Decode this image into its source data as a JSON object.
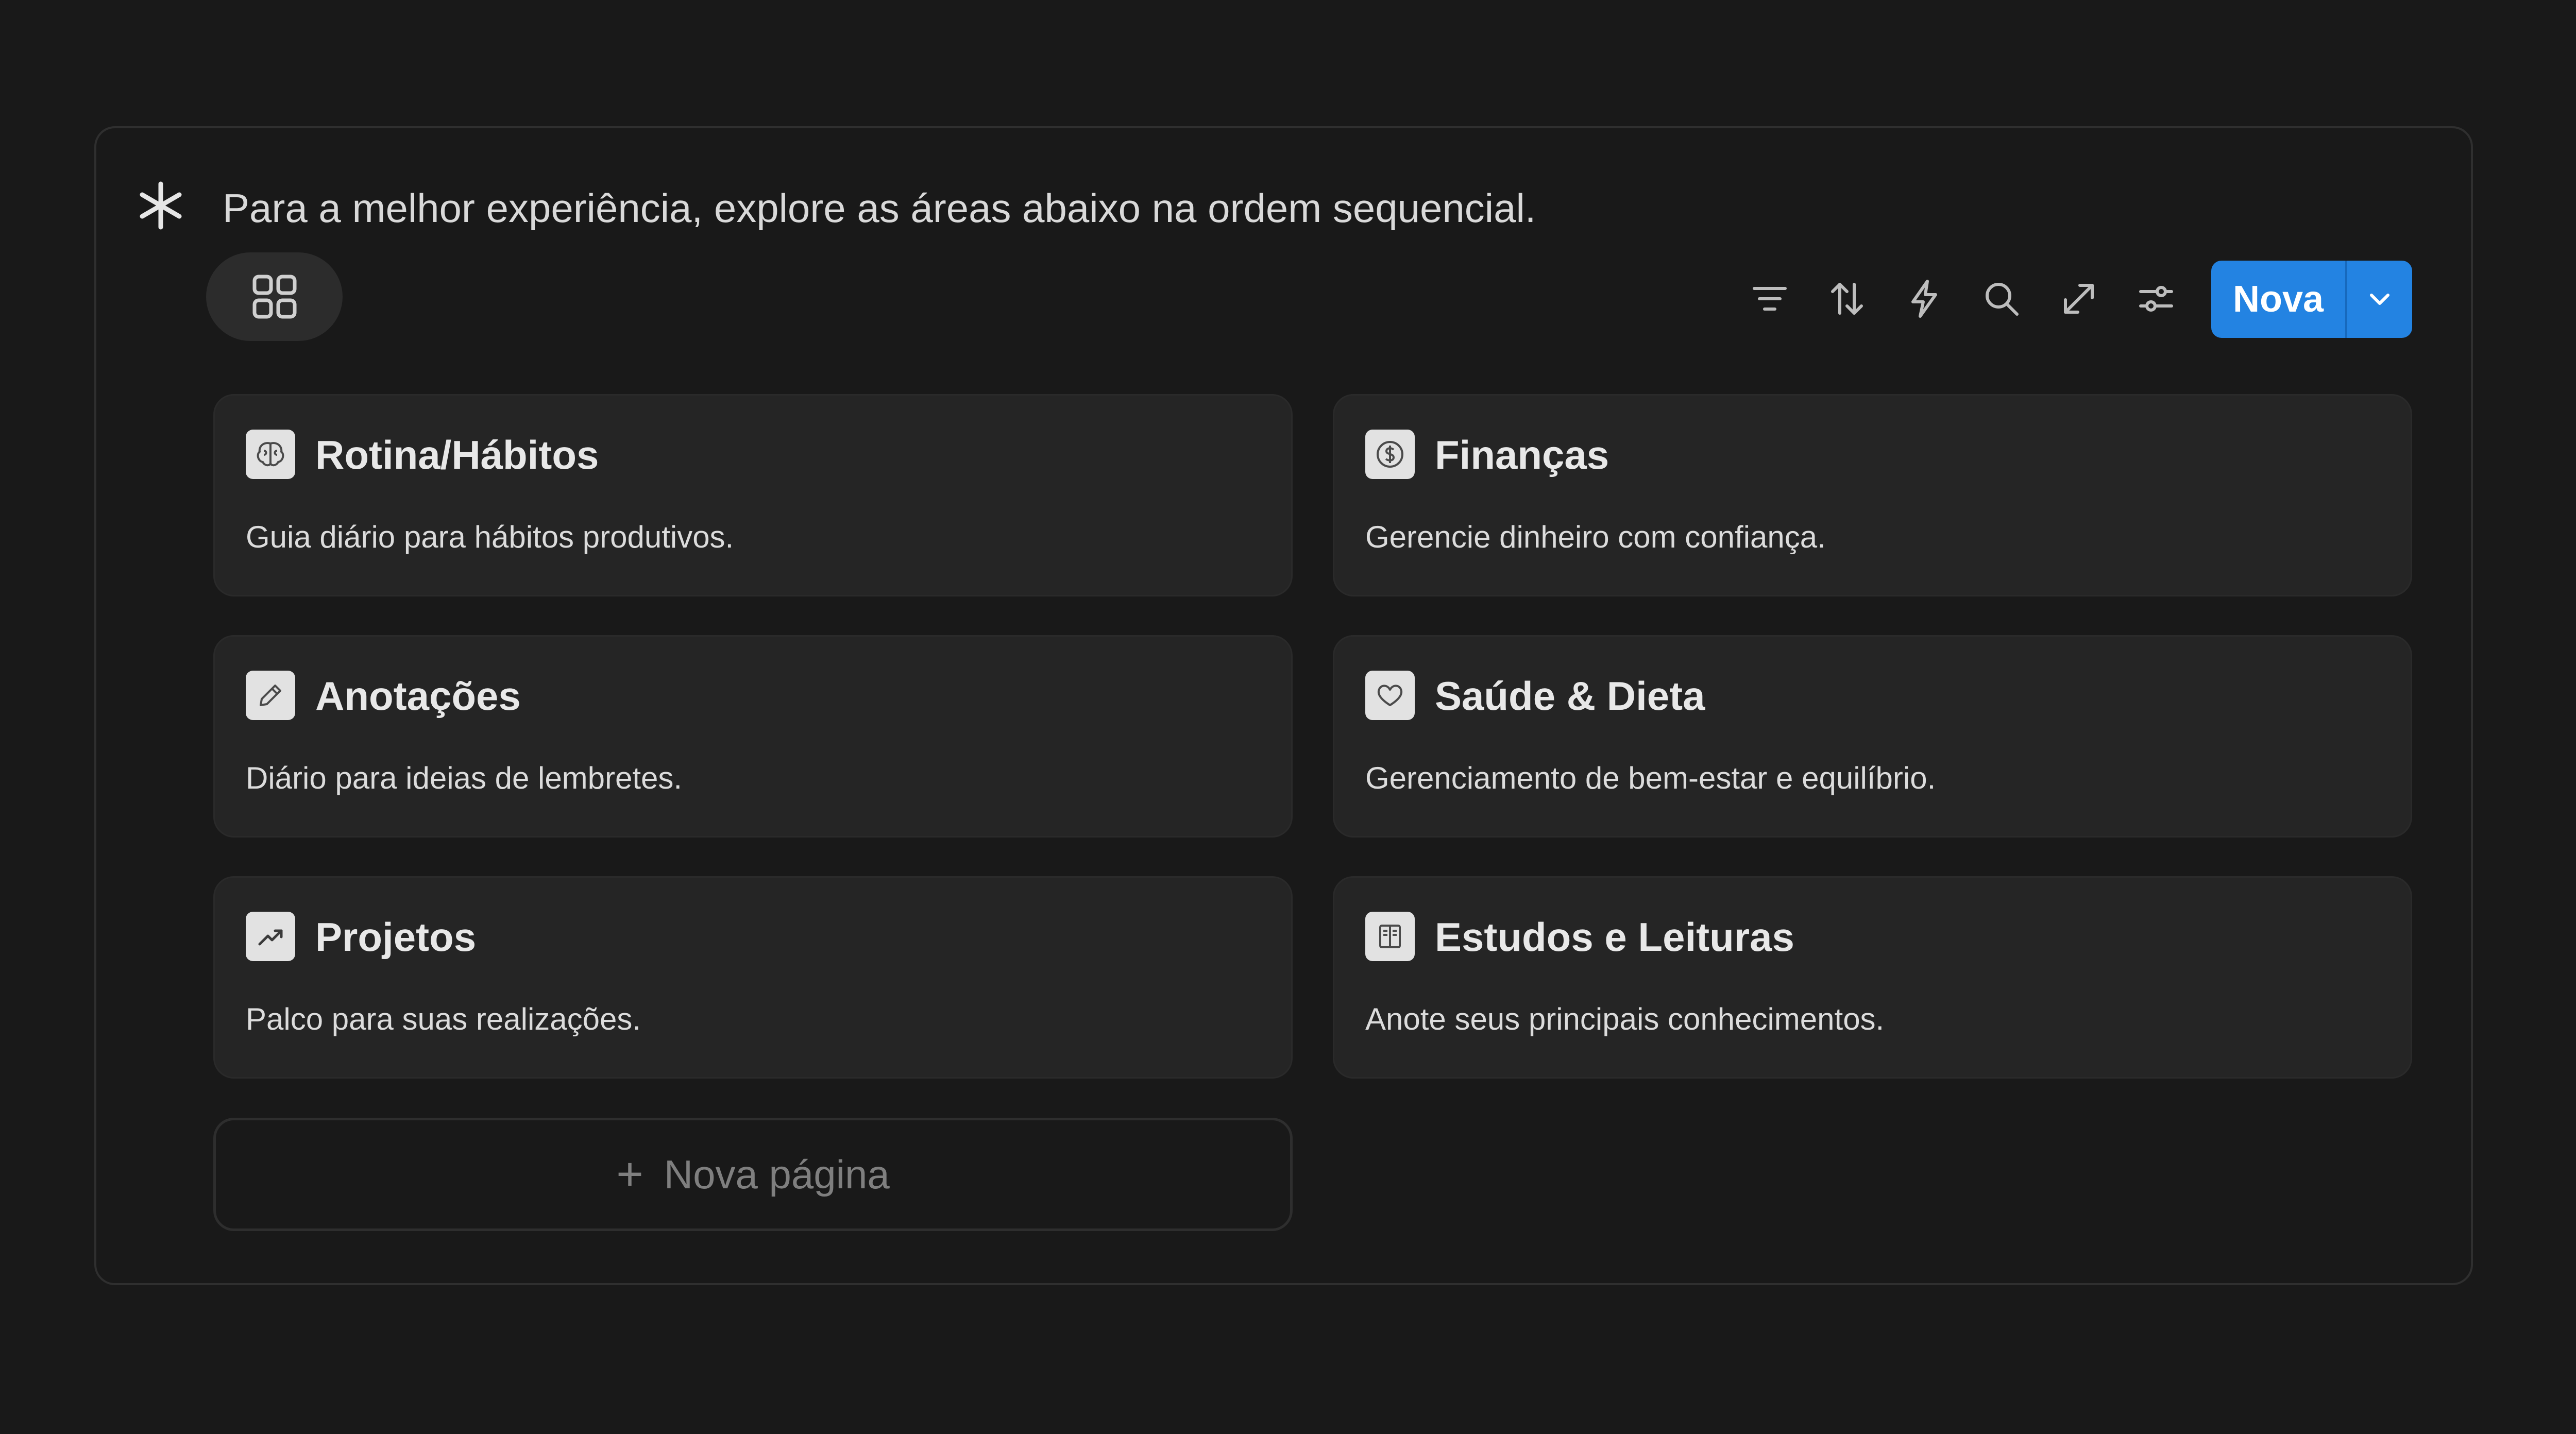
{
  "callout": {
    "icon": "asterisk-icon",
    "text": "Para a melhor experiência, explore as áreas abaixo na ordem sequencial."
  },
  "view": {
    "active_tab_icon": "gallery-grid-icon"
  },
  "toolbar": {
    "icons": [
      "filter-icon",
      "sort-icon",
      "automation-bolt-icon",
      "search-icon",
      "expand-icon",
      "settings-sliders-icon"
    ],
    "new_label": "Nova",
    "new_dropdown_icon": "chevron-down-icon",
    "accent_color": "#2383e2"
  },
  "cards": [
    {
      "icon": "brain-icon",
      "title": "Rotina/Hábitos",
      "desc": "Guia diário para hábitos produtivos."
    },
    {
      "icon": "dollar-coin-icon",
      "title": "Finanças",
      "desc": "Gerencie dinheiro com confiança."
    },
    {
      "icon": "pencil-icon",
      "title": "Anotações",
      "desc": "Diário para ideias de lembretes."
    },
    {
      "icon": "heart-icon",
      "title": "Saúde & Dieta",
      "desc": "Gerenciamento de bem-estar e equilíbrio."
    },
    {
      "icon": "trend-up-icon",
      "title": "Projetos",
      "desc": "Palco para suas realizações."
    },
    {
      "icon": "book-icon",
      "title": "Estudos e Leituras",
      "desc": "Anote seus principais conhecimentos."
    }
  ],
  "add_page": {
    "plus": "+",
    "label": "Nova página"
  }
}
